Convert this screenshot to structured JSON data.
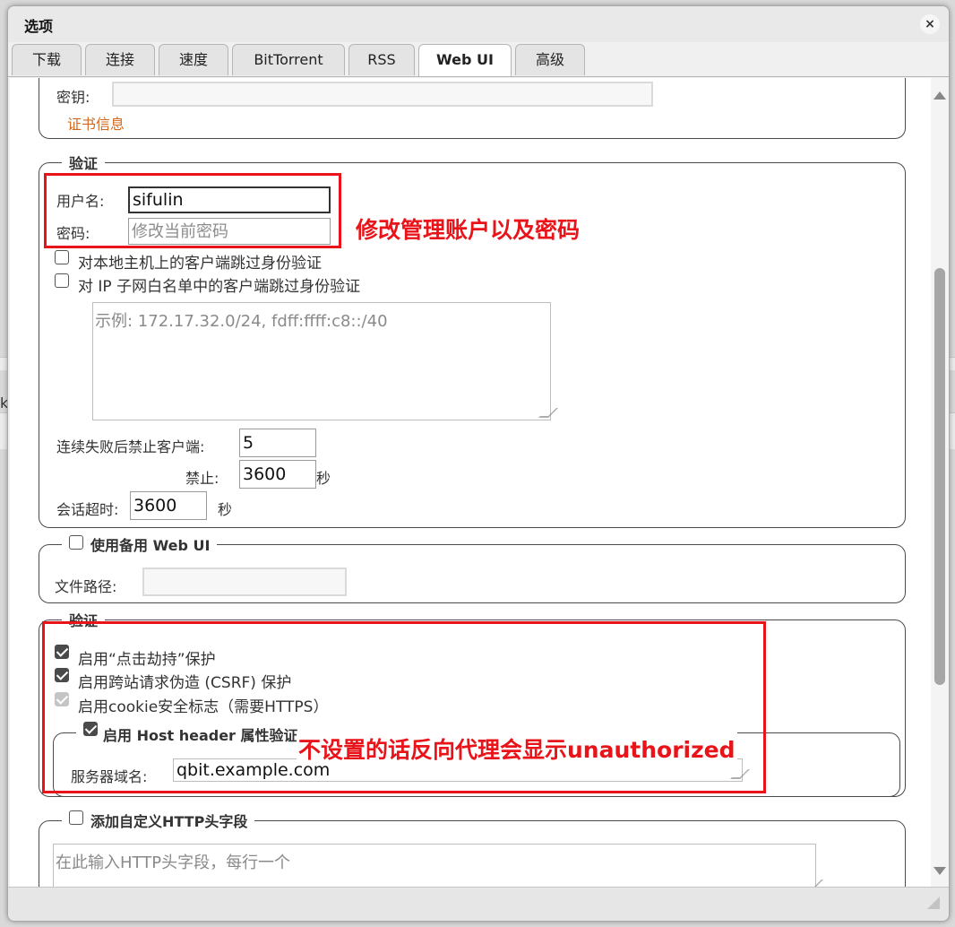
{
  "dialog": {
    "title": "选项",
    "close_icon": "×"
  },
  "tabs": [
    {
      "label": "下载"
    },
    {
      "label": "连接"
    },
    {
      "label": "速度"
    },
    {
      "label": "BitTorrent"
    },
    {
      "label": "RSS"
    },
    {
      "label": "Web UI",
      "active": true
    },
    {
      "label": "高级"
    }
  ],
  "https": {
    "key_label": "密钥:",
    "cert_link": "证书信息"
  },
  "auth": {
    "legend": "验证",
    "username_label": "用户名:",
    "username_value": "sifulin",
    "password_label": "密码:",
    "password_placeholder": "修改当前密码",
    "bypass_localhost": "对本地主机上的客户端跳过身份验证",
    "bypass_whitelist": "对 IP 子网白名单中的客户端跳过身份验证",
    "whitelist_placeholder": "示例: 172.17.32.0/24, fdff:ffff:c8::/40",
    "ban_after_label": "连续失败后禁止客户端:",
    "ban_after_value": "5",
    "ban_label": "禁止:",
    "ban_value": "3600",
    "ban_unit": "秒",
    "session_label": "会话超时:",
    "session_value": "3600",
    "session_unit": "秒"
  },
  "alt_webui": {
    "legend": "使用备用 Web UI",
    "path_label": "文件路径:"
  },
  "security": {
    "legend": "验证",
    "clickjacking": "启用“点击劫持”保护",
    "csrf": "启用跨站请求伪造 (CSRF) 保护",
    "cookie": "启用cookie安全标志（需要HTTPS）",
    "host_header_legend": "启用 Host header 属性验证",
    "server_domains_label": "服务器域名:",
    "server_domains_value": "qbit.example.com"
  },
  "custom_headers": {
    "legend": "添加自定义HTTP头字段",
    "placeholder": "在此输入HTTP头字段，每行一个"
  },
  "annotations": {
    "credentials_note": "修改管理账户以及密码",
    "host_note": "不设置的话反向代理会显示unauthorized"
  },
  "colors": {
    "annotation_red": "#e8141a",
    "link_orange": "#d2691e"
  }
}
